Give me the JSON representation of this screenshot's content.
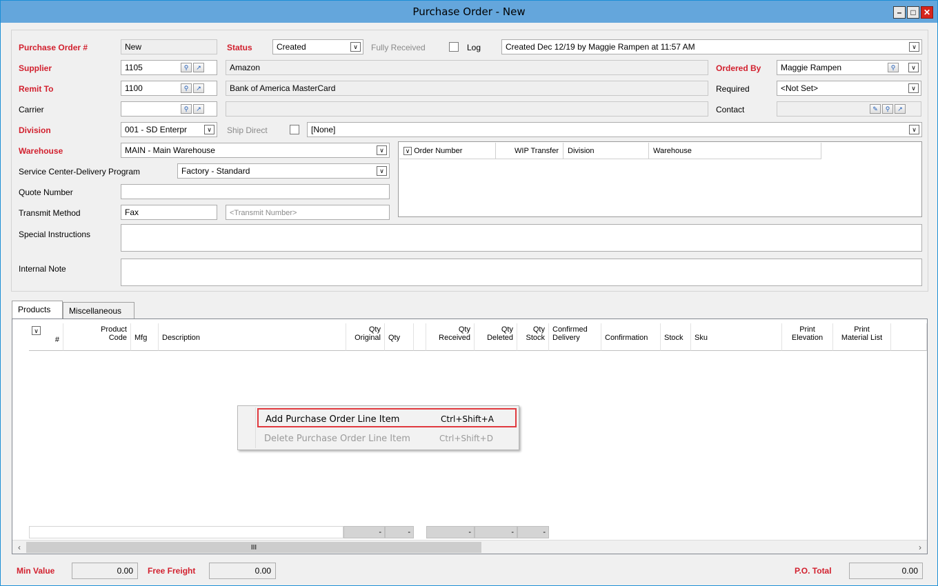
{
  "window": {
    "title": "Purchase Order - New"
  },
  "form": {
    "po_number_label": "Purchase Order #",
    "po_number": "New",
    "status_label": "Status",
    "status_value": "Created",
    "fully_received_label": "Fully Received",
    "log_label": "Log",
    "log_value": "Created Dec 12/19 by Maggie Rampen at 11:57 AM",
    "supplier_label": "Supplier",
    "supplier_code": "1105",
    "supplier_name": "Amazon",
    "ordered_by_label": "Ordered By",
    "ordered_by_value": "Maggie Rampen",
    "remit_to_label": "Remit To",
    "remit_to_code": "1100",
    "remit_to_name": "Bank of America MasterCard",
    "required_label": "Required",
    "required_value": "<Not Set>",
    "carrier_label": "Carrier",
    "carrier_code": "",
    "carrier_name": "",
    "contact_label": "Contact",
    "contact_value": "",
    "division_label": "Division",
    "division_value": "001 - SD Enterpr",
    "ship_direct_label": "Ship Direct",
    "ship_direct_value": "[None]",
    "warehouse_label": "Warehouse",
    "warehouse_value": "MAIN - Main Warehouse",
    "service_center_label": "Service Center-Delivery Program",
    "service_center_value": "Factory - Standard",
    "quote_number_label": "Quote Number",
    "quote_number_value": "",
    "transmit_method_label": "Transmit Method",
    "transmit_method_value": "Fax",
    "transmit_number_placeholder": "<Transmit Number>",
    "special_instructions_label": "Special Instructions",
    "internal_note_label": "Internal Note"
  },
  "wip_grid": {
    "columns": [
      "Order Number",
      "WIP Transfer",
      "Division",
      "Warehouse"
    ]
  },
  "tabs": [
    "Products",
    "Miscellaneous"
  ],
  "products_grid": {
    "columns": [
      {
        "l1": "",
        "l2": "#"
      },
      {
        "l1": "Product",
        "l2": "Code"
      },
      {
        "l1": "",
        "l2": "Mfg"
      },
      {
        "l1": "",
        "l2": "Description"
      },
      {
        "l1": "Qty",
        "l2": "Original"
      },
      {
        "l1": "",
        "l2": "Qty"
      },
      {
        "l1": "Qty",
        "l2": "Received"
      },
      {
        "l1": "Qty",
        "l2": "Deleted"
      },
      {
        "l1": "Qty",
        "l2": "Stock"
      },
      {
        "l1": "Confirmed",
        "l2": "Delivery"
      },
      {
        "l1": "",
        "l2": "Confirmation"
      },
      {
        "l1": "",
        "l2": "Stock"
      },
      {
        "l1": "",
        "l2": "Sku"
      },
      {
        "l1": "Print",
        "l2": "Elevation"
      },
      {
        "l1": "Print",
        "l2": "Material List"
      }
    ],
    "summary": [
      "-",
      "-",
      "-",
      "-",
      "-"
    ],
    "scroll_grip": "III"
  },
  "context_menu": {
    "items": [
      {
        "label": "Add Purchase Order Line Item",
        "shortcut": "Ctrl+Shift+A",
        "enabled": true
      },
      {
        "label": "Delete Purchase Order Line Item",
        "shortcut": "Ctrl+Shift+D",
        "enabled": false
      }
    ]
  },
  "footer": {
    "min_value_label": "Min Value",
    "min_value": "0.00",
    "free_freight_label": "Free Freight",
    "free_freight": "0.00",
    "po_total_label": "P.O. Total",
    "po_total": "0.00"
  },
  "colors": {
    "required": "#d2202e",
    "titlebar": "#64a6dc",
    "highlight": "#e0393e"
  }
}
